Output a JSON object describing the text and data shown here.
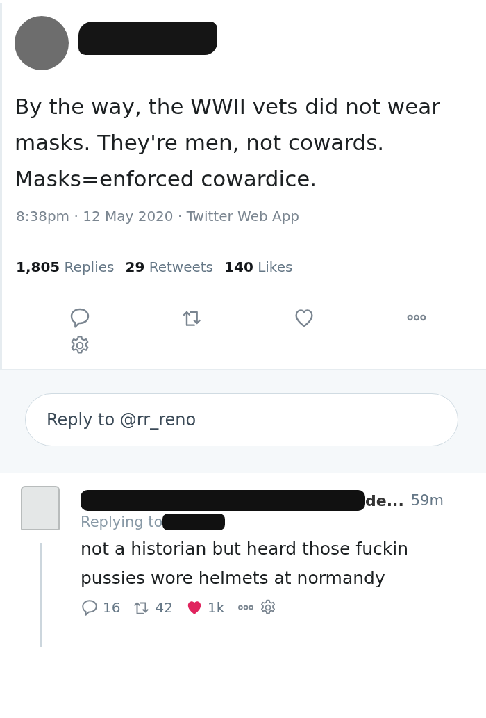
{
  "tweet": {
    "text": "By the way, the WWII vets did not wear masks. They're men, not cowards. Masks=enforced cowardice.",
    "meta": "8:38pm · 12 May 2020 · Twitter Web App",
    "stats": [
      {
        "count": "1,805",
        "label": "Replies"
      },
      {
        "count": "29",
        "label": "Retweets"
      },
      {
        "count": "140",
        "label": "Likes"
      }
    ],
    "liked": false
  },
  "reply_box": {
    "placeholder": "Reply to @rr_reno"
  },
  "reply": {
    "author_tail": "de...",
    "time": "59m",
    "replying_to": "Replying to",
    "text": "not a historian but heard those fuckin pussies wore helmets at normandy",
    "replies": "16",
    "retweets": "42",
    "likes": "1k",
    "liked": true
  }
}
